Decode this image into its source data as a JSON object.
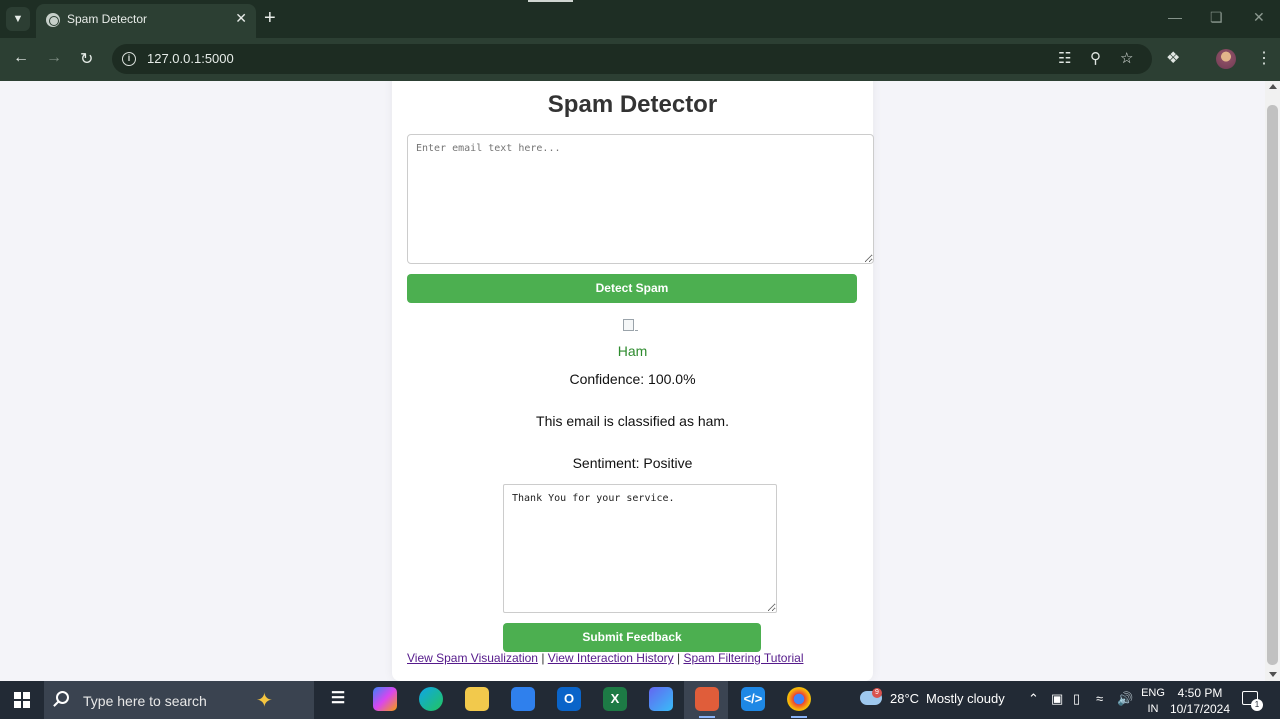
{
  "browser": {
    "tab_title": "Spam Detector",
    "url": "127.0.0.1:5000",
    "tab_menu_icon": "chevron-down-icon",
    "new_tab_icon": "plus-icon",
    "close_icon": "close-icon"
  },
  "page": {
    "title": "Spam Detector",
    "email_placeholder": "Enter email text here...",
    "email_value": "",
    "detect_button": "Detect Spam",
    "broken_image_alt": "Ham",
    "result_label": "Ham",
    "confidence": "Confidence: 100.0%",
    "classification": "This email is classified as ham.",
    "sentiment": "Sentiment: Positive",
    "feedback_value": "Thank You for your service.",
    "submit_button": "Submit Feedback",
    "links": [
      "View Spam Visualization",
      "View Interaction History",
      "Spam Filtering Tutorial"
    ],
    "link_separator": "|",
    "accent_color": "#4caf50",
    "result_color": "#2e8b2e"
  },
  "taskbar": {
    "search_placeholder": "Type here to search",
    "weather_temp": "28°C",
    "weather_desc": "Mostly cloudy",
    "weather_badge": "9",
    "lang_top": "ENG",
    "lang_bottom": "IN",
    "time": "4:50 PM",
    "date": "10/17/2024",
    "notification_count": "1"
  }
}
